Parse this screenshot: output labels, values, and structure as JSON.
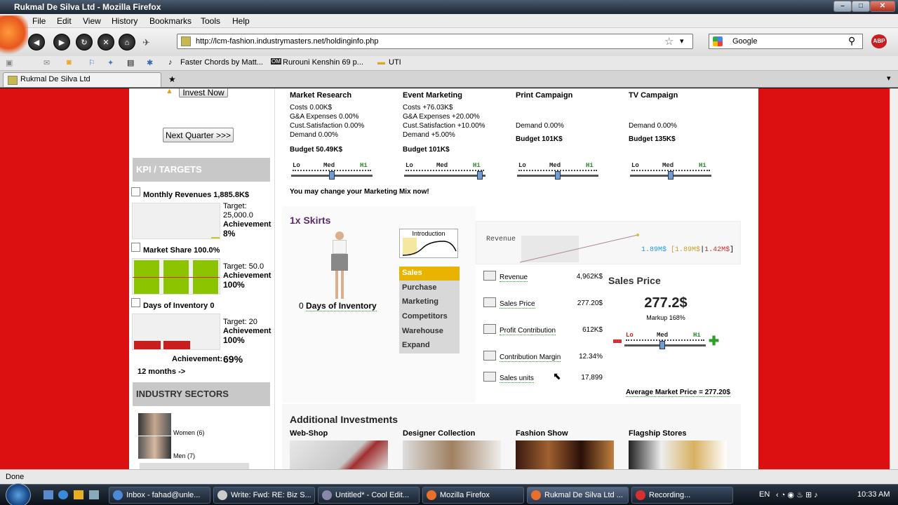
{
  "window": {
    "title": "Rukmal De Silva Ltd - Mozilla Firefox"
  },
  "menu": [
    "File",
    "Edit",
    "View",
    "History",
    "Bookmarks",
    "Tools",
    "Help"
  ],
  "nav": {
    "url": "http://lcm-fashion.industrymasters.net/holdinginfo.php",
    "search_placeholder": "Google"
  },
  "bookmarks": [
    "Faster Chords by Matt...",
    "Rurouni Kenshin 69 p...",
    "UTI"
  ],
  "tab": {
    "label": "Rukmal De Silva Ltd",
    "new_tab": "★"
  },
  "sidebar": {
    "invest_now": "Invest Now",
    "next_quarter": "Next Quarter >>>",
    "kpi_head": "KPI / TARGETS",
    "kpis": [
      {
        "title": "Monthly Revenues 1,885.8K$",
        "target_label": "Target:",
        "target": "25,000.0",
        "ach_label": "Achievement",
        "ach": "8%"
      },
      {
        "title": "Market Share 100.0%",
        "target_label": "Target: 50.0",
        "ach_label": "Achievement",
        "ach": "100%"
      },
      {
        "title": "Days of Inventory 0",
        "target_label": "Target: 20",
        "ach_label": "Achievement",
        "ach": "100%"
      }
    ],
    "overall_label": "Achievement:",
    "overall": "69%",
    "months": "12 months ->",
    "industry_head": "INDUSTRY SECTORS",
    "sectors": [
      "Women (6)",
      "Men (7)"
    ]
  },
  "marketing": [
    {
      "title": "Market Research",
      "lines": [
        "Costs 0.00K$",
        "G&A Expenses 0.00%",
        "Cust.Satisfaction 0.00%",
        "Demand 0.00%"
      ],
      "budget": "Budget 50.49K$"
    },
    {
      "title": "Event Marketing",
      "lines": [
        "Costs +76.03K$",
        "G&A Expenses +20.00%",
        "Cust.Satisfaction +10.00%",
        "Demand +5.00%"
      ],
      "budget": "Budget 101K$"
    },
    {
      "title": "Print Campaign",
      "lines": [
        "Demand 0.00%"
      ],
      "budget": "Budget 101K$"
    },
    {
      "title": "TV Campaign",
      "lines": [
        "Demand 0.00%"
      ],
      "budget": "Budget 135K$"
    }
  ],
  "slider_labels": {
    "lo": "Lo",
    "med": "Med",
    "hi": "Hi"
  },
  "mix_note": "You may change your Marketing Mix now!",
  "product": {
    "title": "1x Skirts",
    "inventory_count": "0",
    "inventory_label": "Days of Inventory",
    "phase": "Introduction",
    "menu": [
      "Sales",
      "Purchase",
      "Marketing",
      "Competitors",
      "Warehouse",
      "Expand"
    ]
  },
  "revenue_chart": {
    "label": "Revenue",
    "v1": "1.89M$",
    "v2": "1.89M$",
    "v3": "1.42M$"
  },
  "stats": [
    {
      "label": "Revenue",
      "value": "4,962K$"
    },
    {
      "label": "Sales Price",
      "value": "277.20$"
    },
    {
      "label": "Profit Contribution",
      "value": "612K$"
    },
    {
      "label": "Contribution Margin",
      "value": "12.34%"
    },
    {
      "label": "Sales units",
      "value": "17,899"
    }
  ],
  "sales_price": {
    "title": "Sales Price",
    "value": "277.2$",
    "markup": "Markup 168%",
    "avg": "Average Market Price = 277.20$"
  },
  "investments": {
    "title": "Additional Investments",
    "items": [
      "Web-Shop",
      "Designer Collection",
      "Fashion Show",
      "Flagship Stores"
    ]
  },
  "status": "Done",
  "taskbar": {
    "tasks": [
      "Inbox - fahad@unle...",
      "Write: Fwd: RE: Biz S...",
      "Untitled* - Cool Edit...",
      "Mozilla Firefox",
      "Rukmal De Silva Ltd ...",
      "Recording..."
    ],
    "lang": "EN",
    "clock": "10:33 AM"
  }
}
